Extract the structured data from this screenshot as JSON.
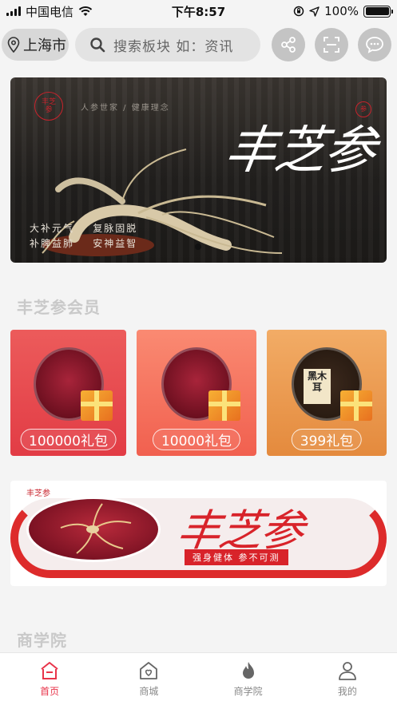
{
  "status_bar": {
    "carrier": "中国电信",
    "time": "下午8:57",
    "battery": "100%"
  },
  "header": {
    "city": "上海市",
    "search_placeholder": "搜索板块  如：资讯",
    "icons": [
      "location-pin-icon",
      "search-icon",
      "share-icon",
      "scan-icon",
      "message-icon"
    ]
  },
  "banner": {
    "brand": "丰芝参",
    "tagline": "人参世家 / 健康理念",
    "slogans": [
      "大补元气",
      "复脉固脱",
      "补脾益肺",
      "安神益智"
    ],
    "slide_count": 1,
    "active_slide": 0
  },
  "member_section": {
    "title": "丰芝参会员",
    "cards": [
      {
        "label": "100000礼包",
        "color": "#e5474b"
      },
      {
        "label": "10000礼包",
        "color": "#f27259"
      },
      {
        "label": "399礼包",
        "color": "#e8994e"
      }
    ],
    "card3_product_text": "黑木耳"
  },
  "promo_banner": {
    "brand": "丰芝参",
    "tagline": "强身健体    参不可测"
  },
  "academy_section": {
    "title": "商学院"
  },
  "tab_bar": {
    "items": [
      {
        "label": "首页",
        "icon": "home-icon",
        "active": true
      },
      {
        "label": "商城",
        "icon": "shop-icon",
        "active": false
      },
      {
        "label": "商学院",
        "icon": "flame-icon",
        "active": false
      },
      {
        "label": "我的",
        "icon": "user-icon",
        "active": false
      }
    ],
    "active_color": "#e8344a"
  }
}
